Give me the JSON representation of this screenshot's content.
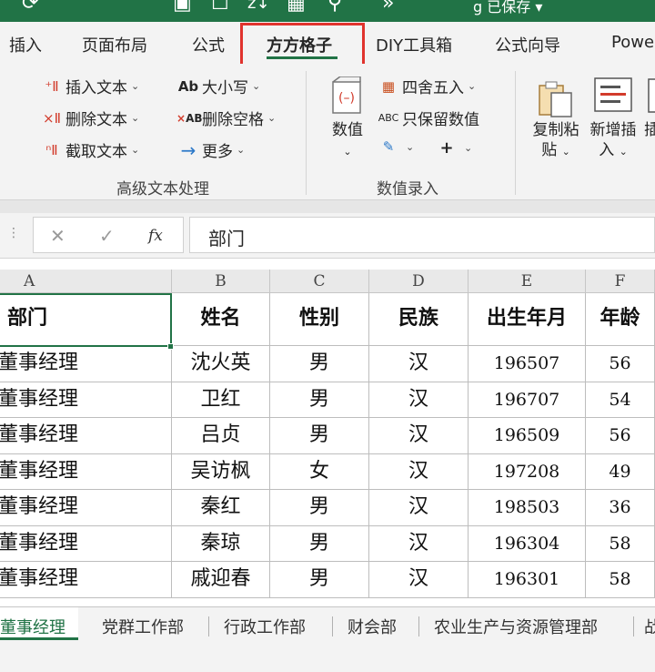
{
  "titlebar": {
    "text": "g  已保存 ▾"
  },
  "tabs": [
    {
      "label": "插入"
    },
    {
      "label": "页面布局"
    },
    {
      "label": "公式"
    },
    {
      "label": "方方格子"
    },
    {
      "label": "DIY工具箱"
    },
    {
      "label": "公式向导"
    },
    {
      "label": "Powe"
    }
  ],
  "ribbon": {
    "text_group": {
      "items": [
        "插入文本",
        "删除文本",
        "截取文本",
        "大小写",
        "删除空格",
        "更多"
      ],
      "label": "高级文本处理"
    },
    "value_group": {
      "items": [
        "数值",
        "四舍五入",
        "只保留数值"
      ],
      "label": "数值录入"
    },
    "big_buttons": [
      {
        "line1": "复制粘",
        "line2": "贴"
      },
      {
        "line1": "新增插",
        "line2": "入"
      },
      {
        "line1": "插",
        "line2": ""
      }
    ]
  },
  "formula_bar": {
    "cancel": "✕",
    "enter": "✓",
    "fx": "fx",
    "value": "部门"
  },
  "columns": [
    "A",
    "B",
    "C",
    "D",
    "E",
    "F"
  ],
  "table": {
    "headers": [
      "部门",
      "姓名",
      "性别",
      "民族",
      "出生年月",
      "年龄"
    ],
    "rows": [
      [
        "董事经理",
        "沈火英",
        "男",
        "汉",
        "196507",
        "56"
      ],
      [
        "董事经理",
        "卫红",
        "男",
        "汉",
        "196707",
        "54"
      ],
      [
        "董事经理",
        "吕贞",
        "男",
        "汉",
        "196509",
        "56"
      ],
      [
        "董事经理",
        "吴访枫",
        "女",
        "汉",
        "197208",
        "49"
      ],
      [
        "董事经理",
        "秦红",
        "男",
        "汉",
        "198503",
        "36"
      ],
      [
        "董事经理",
        "秦琼",
        "男",
        "汉",
        "196304",
        "58"
      ],
      [
        "董事经理",
        "戚迎春",
        "男",
        "汉",
        "196301",
        "58"
      ]
    ]
  },
  "sheets": [
    "董事经理",
    "党群工作部",
    "行政工作部",
    "财会部",
    "农业生产与资源管理部",
    "战"
  ]
}
